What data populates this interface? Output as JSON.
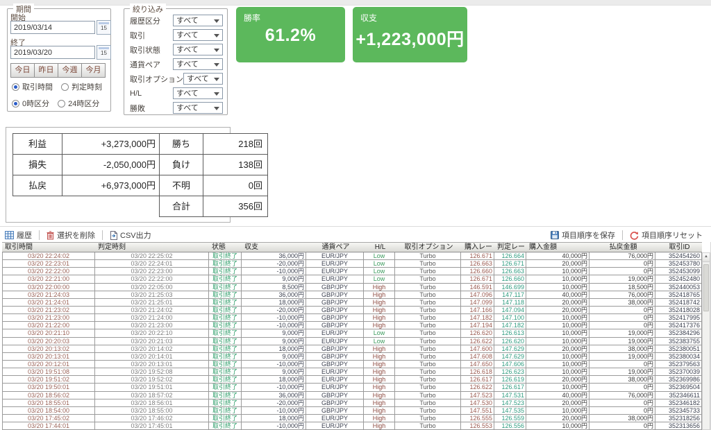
{
  "period": {
    "title": "期間",
    "start_label": "開始",
    "start_value": "2019/03/14",
    "end_label": "終了",
    "end_value": "2019/03/20",
    "calendar_day": "15",
    "quick_buttons": [
      "今日",
      "昨日",
      "今週",
      "今月"
    ],
    "time_mode_options": [
      {
        "label": "取引時間",
        "selected": true
      },
      {
        "label": "判定時刻",
        "selected": false
      }
    ],
    "day_split_options": [
      {
        "label": "0時区分",
        "selected": true
      },
      {
        "label": "24時区分",
        "selected": false
      }
    ]
  },
  "filter": {
    "title": "絞り込み",
    "rows": [
      {
        "label": "履歴区分",
        "value": "すべて"
      },
      {
        "label": "取引",
        "value": "すべて"
      },
      {
        "label": "取引状態",
        "value": "すべて"
      },
      {
        "label": "通貨ペア",
        "value": "すべて"
      },
      {
        "label": "取引オプション",
        "value": "すべて"
      },
      {
        "label": "H/L",
        "value": "すべて"
      },
      {
        "label": "勝敗",
        "value": "すべて"
      }
    ]
  },
  "stats": {
    "accent_green": "#5cb85c",
    "win_rate": {
      "label": "勝率",
      "value": "61.2%"
    },
    "balance": {
      "label": "収支",
      "value": "+1,223,000円"
    }
  },
  "summary": {
    "left": [
      {
        "label": "利益",
        "value": "+3,273,000円"
      },
      {
        "label": "損失",
        "value": "-2,050,000円"
      },
      {
        "label": "払戻",
        "value": "+6,973,000円"
      }
    ],
    "right": [
      {
        "label": "勝ち",
        "value": "218回"
      },
      {
        "label": "負け",
        "value": "138回"
      },
      {
        "label": "不明",
        "value": "0回"
      },
      {
        "label": "合計",
        "value": "356回"
      }
    ]
  },
  "toolbar": {
    "history": "履歴",
    "delete_selection": "選択を削除",
    "csv_export": "CSV出力",
    "save_order": "項目順序を保存",
    "reset_order": "項目順序リセット"
  },
  "table": {
    "columns": [
      "取引時間",
      "判定時刻",
      "状態",
      "収支",
      "通貨ペア",
      "H/L",
      "取引オプション",
      "購入レー",
      "判定レー",
      "購入金額",
      "払戻金額",
      "取引ID"
    ],
    "rows": [
      [
        "03/20 22:24:02",
        "03/20 22:25:02",
        "取引終了",
        "36,000円",
        "EUR/JPY",
        "Low",
        "Turbo",
        "126.671",
        "126.664",
        "40,000円",
        "76,000円",
        "352454260"
      ],
      [
        "03/20 22:23:01",
        "03/20 22:24:01",
        "取引終了",
        "-20,000円",
        "EUR/JPY",
        "Low",
        "Turbo",
        "126.663",
        "126.671",
        "20,000円",
        "0円",
        "352453780"
      ],
      [
        "03/20 22:22:00",
        "03/20 22:23:00",
        "取引終了",
        "-10,000円",
        "EUR/JPY",
        "Low",
        "Turbo",
        "126.660",
        "126.663",
        "10,000円",
        "0円",
        "352453099"
      ],
      [
        "03/20 22:21:00",
        "03/20 22:22:00",
        "取引終了",
        "9,000円",
        "EUR/JPY",
        "Low",
        "Turbo",
        "126.671",
        "126.660",
        "10,000円",
        "19,000円",
        "352452480"
      ],
      [
        "03/20 22:00:00",
        "03/20 22:05:00",
        "取引終了",
        "8,500円",
        "GBP/JPY",
        "High",
        "Turbo",
        "146.591",
        "146.699",
        "10,000円",
        "18,500円",
        "352440053"
      ],
      [
        "03/20 21:24:03",
        "03/20 21:25:03",
        "取引終了",
        "36,000円",
        "GBP/JPY",
        "High",
        "Turbo",
        "147.096",
        "147.117",
        "40,000円",
        "76,000円",
        "352418765"
      ],
      [
        "03/20 21:24:01",
        "03/20 21:25:01",
        "取引終了",
        "18,000円",
        "GBP/JPY",
        "High",
        "Turbo",
        "147.099",
        "147.118",
        "20,000円",
        "38,000円",
        "352418742"
      ],
      [
        "03/20 21:23:02",
        "03/20 21:24:02",
        "取引終了",
        "-20,000円",
        "GBP/JPY",
        "High",
        "Turbo",
        "147.166",
        "147.094",
        "20,000円",
        "0円",
        "352418028"
      ],
      [
        "03/20 21:23:00",
        "03/20 21:24:00",
        "取引終了",
        "-10,000円",
        "GBP/JPY",
        "High",
        "Turbo",
        "147.182",
        "147.100",
        "10,000円",
        "0円",
        "352417995"
      ],
      [
        "03/20 21:22:00",
        "03/20 21:23:00",
        "取引終了",
        "-10,000円",
        "GBP/JPY",
        "High",
        "Turbo",
        "147.194",
        "147.182",
        "10,000円",
        "0円",
        "352417376"
      ],
      [
        "03/20 20:21:10",
        "03/20 20:22:10",
        "取引終了",
        "9,000円",
        "EUR/JPY",
        "Low",
        "Turbo",
        "126.620",
        "126.613",
        "10,000円",
        "19,000円",
        "352384296"
      ],
      [
        "03/20 20:20:03",
        "03/20 20:21:03",
        "取引終了",
        "9,000円",
        "EUR/JPY",
        "Low",
        "Turbo",
        "126.622",
        "126.620",
        "10,000円",
        "19,000円",
        "352383755"
      ],
      [
        "03/20 20:13:02",
        "03/20 20:14:02",
        "取引終了",
        "18,000円",
        "GBP/JPY",
        "High",
        "Turbo",
        "147.600",
        "147.629",
        "20,000円",
        "38,000円",
        "352380051"
      ],
      [
        "03/20 20:13:01",
        "03/20 20:14:01",
        "取引終了",
        "9,000円",
        "GBP/JPY",
        "High",
        "Turbo",
        "147.608",
        "147.629",
        "10,000円",
        "19,000円",
        "352380034"
      ],
      [
        "03/20 20:12:01",
        "03/20 20:13:01",
        "取引終了",
        "-10,000円",
        "GBP/JPY",
        "High",
        "Turbo",
        "147.650",
        "147.606",
        "10,000円",
        "0円",
        "352379563"
      ],
      [
        "03/20 19:51:08",
        "03/20 19:52:08",
        "取引終了",
        "9,000円",
        "EUR/JPY",
        "High",
        "Turbo",
        "126.618",
        "126.623",
        "10,000円",
        "19,000円",
        "352370039"
      ],
      [
        "03/20 19:51:02",
        "03/20 19:52:02",
        "取引終了",
        "18,000円",
        "EUR/JPY",
        "High",
        "Turbo",
        "126.617",
        "126.619",
        "20,000円",
        "38,000円",
        "352369986"
      ],
      [
        "03/20 19:50:01",
        "03/20 19:51:01",
        "取引終了",
        "-10,000円",
        "EUR/JPY",
        "High",
        "Turbo",
        "126.622",
        "126.617",
        "10,000円",
        "0円",
        "352369504"
      ],
      [
        "03/20 18:56:02",
        "03/20 18:57:02",
        "取引終了",
        "36,000円",
        "GBP/JPY",
        "High",
        "Turbo",
        "147.523",
        "147.531",
        "40,000円",
        "76,000円",
        "352346611"
      ],
      [
        "03/20 18:55:01",
        "03/20 18:56:01",
        "取引終了",
        "-20,000円",
        "GBP/JPY",
        "High",
        "Turbo",
        "147.530",
        "147.523",
        "20,000円",
        "0円",
        "352346182"
      ],
      [
        "03/20 18:54:00",
        "03/20 18:55:00",
        "取引終了",
        "-10,000円",
        "GBP/JPY",
        "High",
        "Turbo",
        "147.551",
        "147.535",
        "10,000円",
        "0円",
        "352345733"
      ],
      [
        "03/20 17:45:02",
        "03/20 17:46:02",
        "取引終了",
        "18,000円",
        "EUR/JPY",
        "High",
        "Turbo",
        "126.555",
        "126.559",
        "20,000円",
        "38,000円",
        "352318256"
      ],
      [
        "03/20 17:44:01",
        "03/20 17:45:01",
        "取引終了",
        "-10,000円",
        "EUR/JPY",
        "High",
        "Turbo",
        "126.553",
        "126.556",
        "10,000円",
        "0円",
        "352313656"
      ]
    ]
  }
}
